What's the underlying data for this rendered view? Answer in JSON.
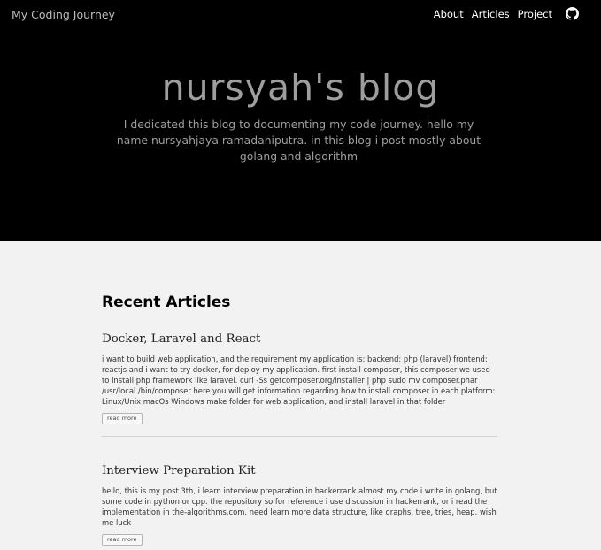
{
  "header": {
    "brand": "My Coding Journey",
    "nav": [
      {
        "label": "About"
      },
      {
        "label": "Articles"
      },
      {
        "label": "Project"
      }
    ],
    "github_icon": "github-icon"
  },
  "hero": {
    "title": "nursyah's blog",
    "description": "I dedicated this blog to documenting my code journey. hello my name nursyahjaya ramadaniputra. in this blog i post mostly about golang and algorithm"
  },
  "main": {
    "section_title": "Recent Articles",
    "articles": [
      {
        "title": "Docker, Laravel and React",
        "excerpt": "i want to build web application, and the requirement my application is: backend: php (laravel) frontend: reactjs and i want to try docker, for deploy my application. first install composer, this composer we used to install php framework like laravel. curl -Ss getcomposer.org/installer | php sudo mv composer.phar /usr/local /bin/composer here you will get information regarding how to install composer in each platform: Linux/Unix macOs Windows make folder for web application, and install laravel in that folder",
        "read_more": "read more"
      },
      {
        "title": "Interview Preparation Kit",
        "excerpt": "hello, this is my post 3th, i learn interview preparation in hackerrank almost my code i write in golang, but some code in python or cpp. the repository so for reference i use discussion in hackerrank, or i read the implementation in the-algorithms.com. need learn more data structure, like graphs, tree, tries, heap. wish me luck",
        "read_more": "read more"
      }
    ]
  },
  "colors": {
    "hero_background": "#000000",
    "page_background": "#f2f2f2",
    "hero_text": "#9e9e9e",
    "nav_text": "#ffffff"
  }
}
